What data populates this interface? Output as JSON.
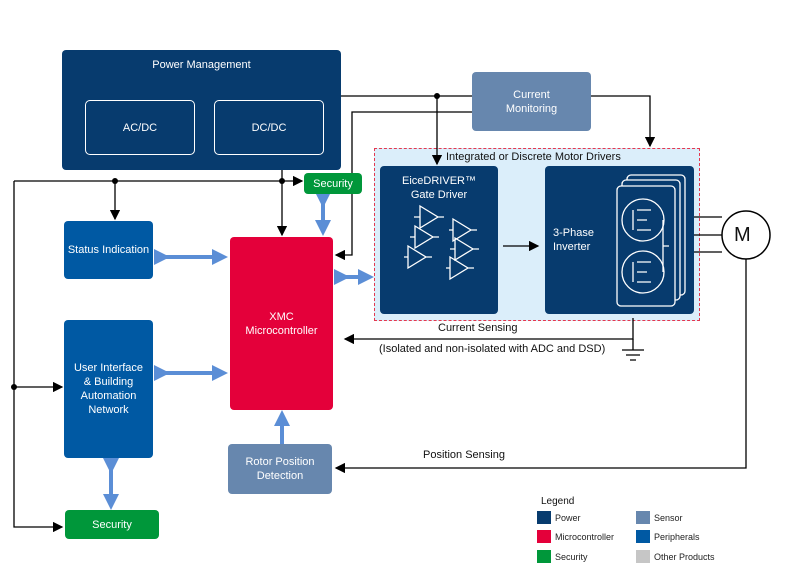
{
  "power_management": {
    "title": "Power Management",
    "acdc": "AC/DC",
    "dcdc": "DC/DC"
  },
  "current_monitoring": "Current Monitoring",
  "motor_drivers": {
    "title": "Integrated or Discrete Motor Drivers",
    "gate_driver": "EiceDRIVER™ Gate Driver",
    "inverter": "3-Phase Inverter"
  },
  "motor": "M",
  "security_top": "Security",
  "status_indication": "Status Indication",
  "microcontroller": "XMC Microcontroller",
  "user_interface": "User Interface & Building Automation Network",
  "security_bottom": "Security",
  "rotor_position": "Rotor Position Detection",
  "current_sensing": "Current Sensing",
  "current_sensing_note": "(Isolated and non-isolated with ADC and DSD)",
  "position_sensing": "Position Sensing",
  "legend": {
    "title": "Legend",
    "items": [
      {
        "label": "Power",
        "color": "#073b6e"
      },
      {
        "label": "Microcontroller",
        "color": "#e4003a"
      },
      {
        "label": "Security",
        "color": "#00973a"
      },
      {
        "label": "Sensor",
        "color": "#6787ae"
      },
      {
        "label": "Peripherals",
        "color": "#0059a3"
      },
      {
        "label": "Other Products",
        "color": "#c6c6c6"
      }
    ]
  }
}
